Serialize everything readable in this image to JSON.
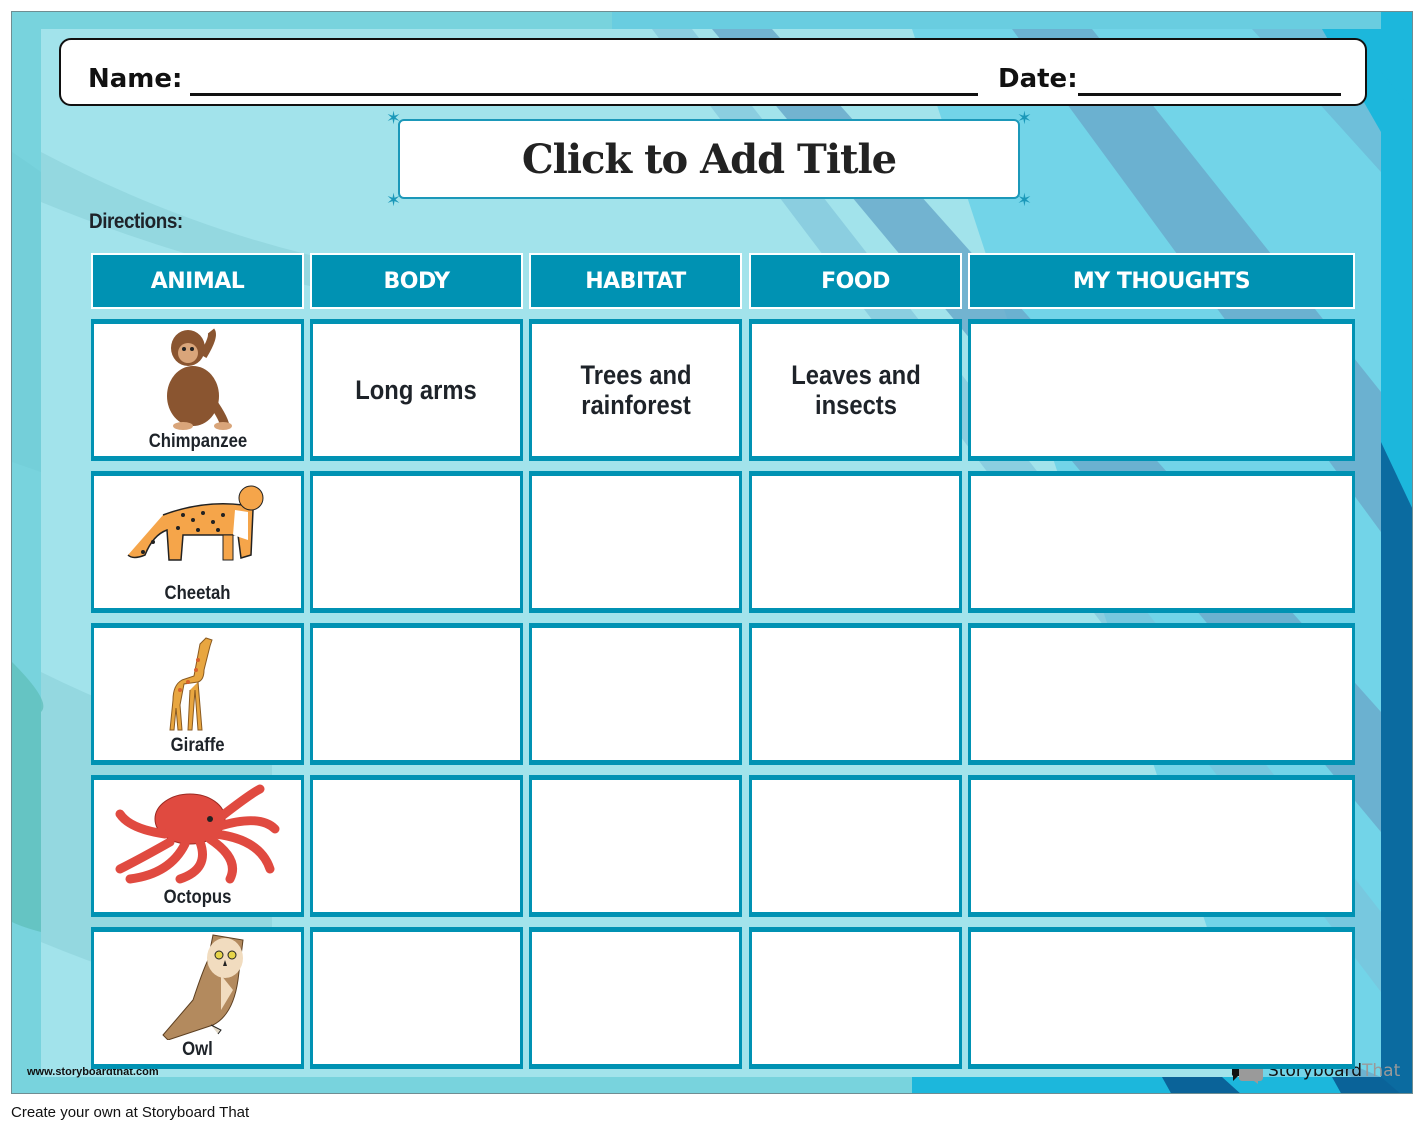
{
  "header": {
    "name_label": "Name:",
    "date_label": "Date:"
  },
  "title": "Click to Add Title",
  "directions_label": "Directions:",
  "table": {
    "columns": [
      "ANIMAL",
      "BODY",
      "HABITAT",
      "FOOD",
      "MY THOUGHTS"
    ],
    "rows": [
      {
        "animal": "Chimpanzee",
        "icon": "chimpanzee-icon",
        "body": "Long arms",
        "habitat": "Trees and rainforest",
        "food": "Leaves and insects",
        "thoughts": ""
      },
      {
        "animal": "Cheetah",
        "icon": "cheetah-icon",
        "body": "",
        "habitat": "",
        "food": "",
        "thoughts": ""
      },
      {
        "animal": "Giraffe",
        "icon": "giraffe-icon",
        "body": "",
        "habitat": "",
        "food": "",
        "thoughts": ""
      },
      {
        "animal": "Octopus",
        "icon": "octopus-icon",
        "body": "",
        "habitat": "",
        "food": "",
        "thoughts": ""
      },
      {
        "animal": "Owl",
        "icon": "owl-icon",
        "body": "",
        "habitat": "",
        "food": "",
        "thoughts": ""
      }
    ]
  },
  "watermark_url": "www.storyboardthat.com",
  "logo": {
    "part1": "Storyboard",
    "part2": "That"
  },
  "footer_text": "Create your own at Storyboard That",
  "colors": {
    "header_fill": "#0092b3",
    "cell_border": "#0092b3",
    "background_light": "#a2e3eb",
    "background_frame": "#78d3dd",
    "stripe_dark": "#0a6399",
    "stripe_mid": "#6aaacb",
    "stripe_bright": "#1cb7dc"
  }
}
